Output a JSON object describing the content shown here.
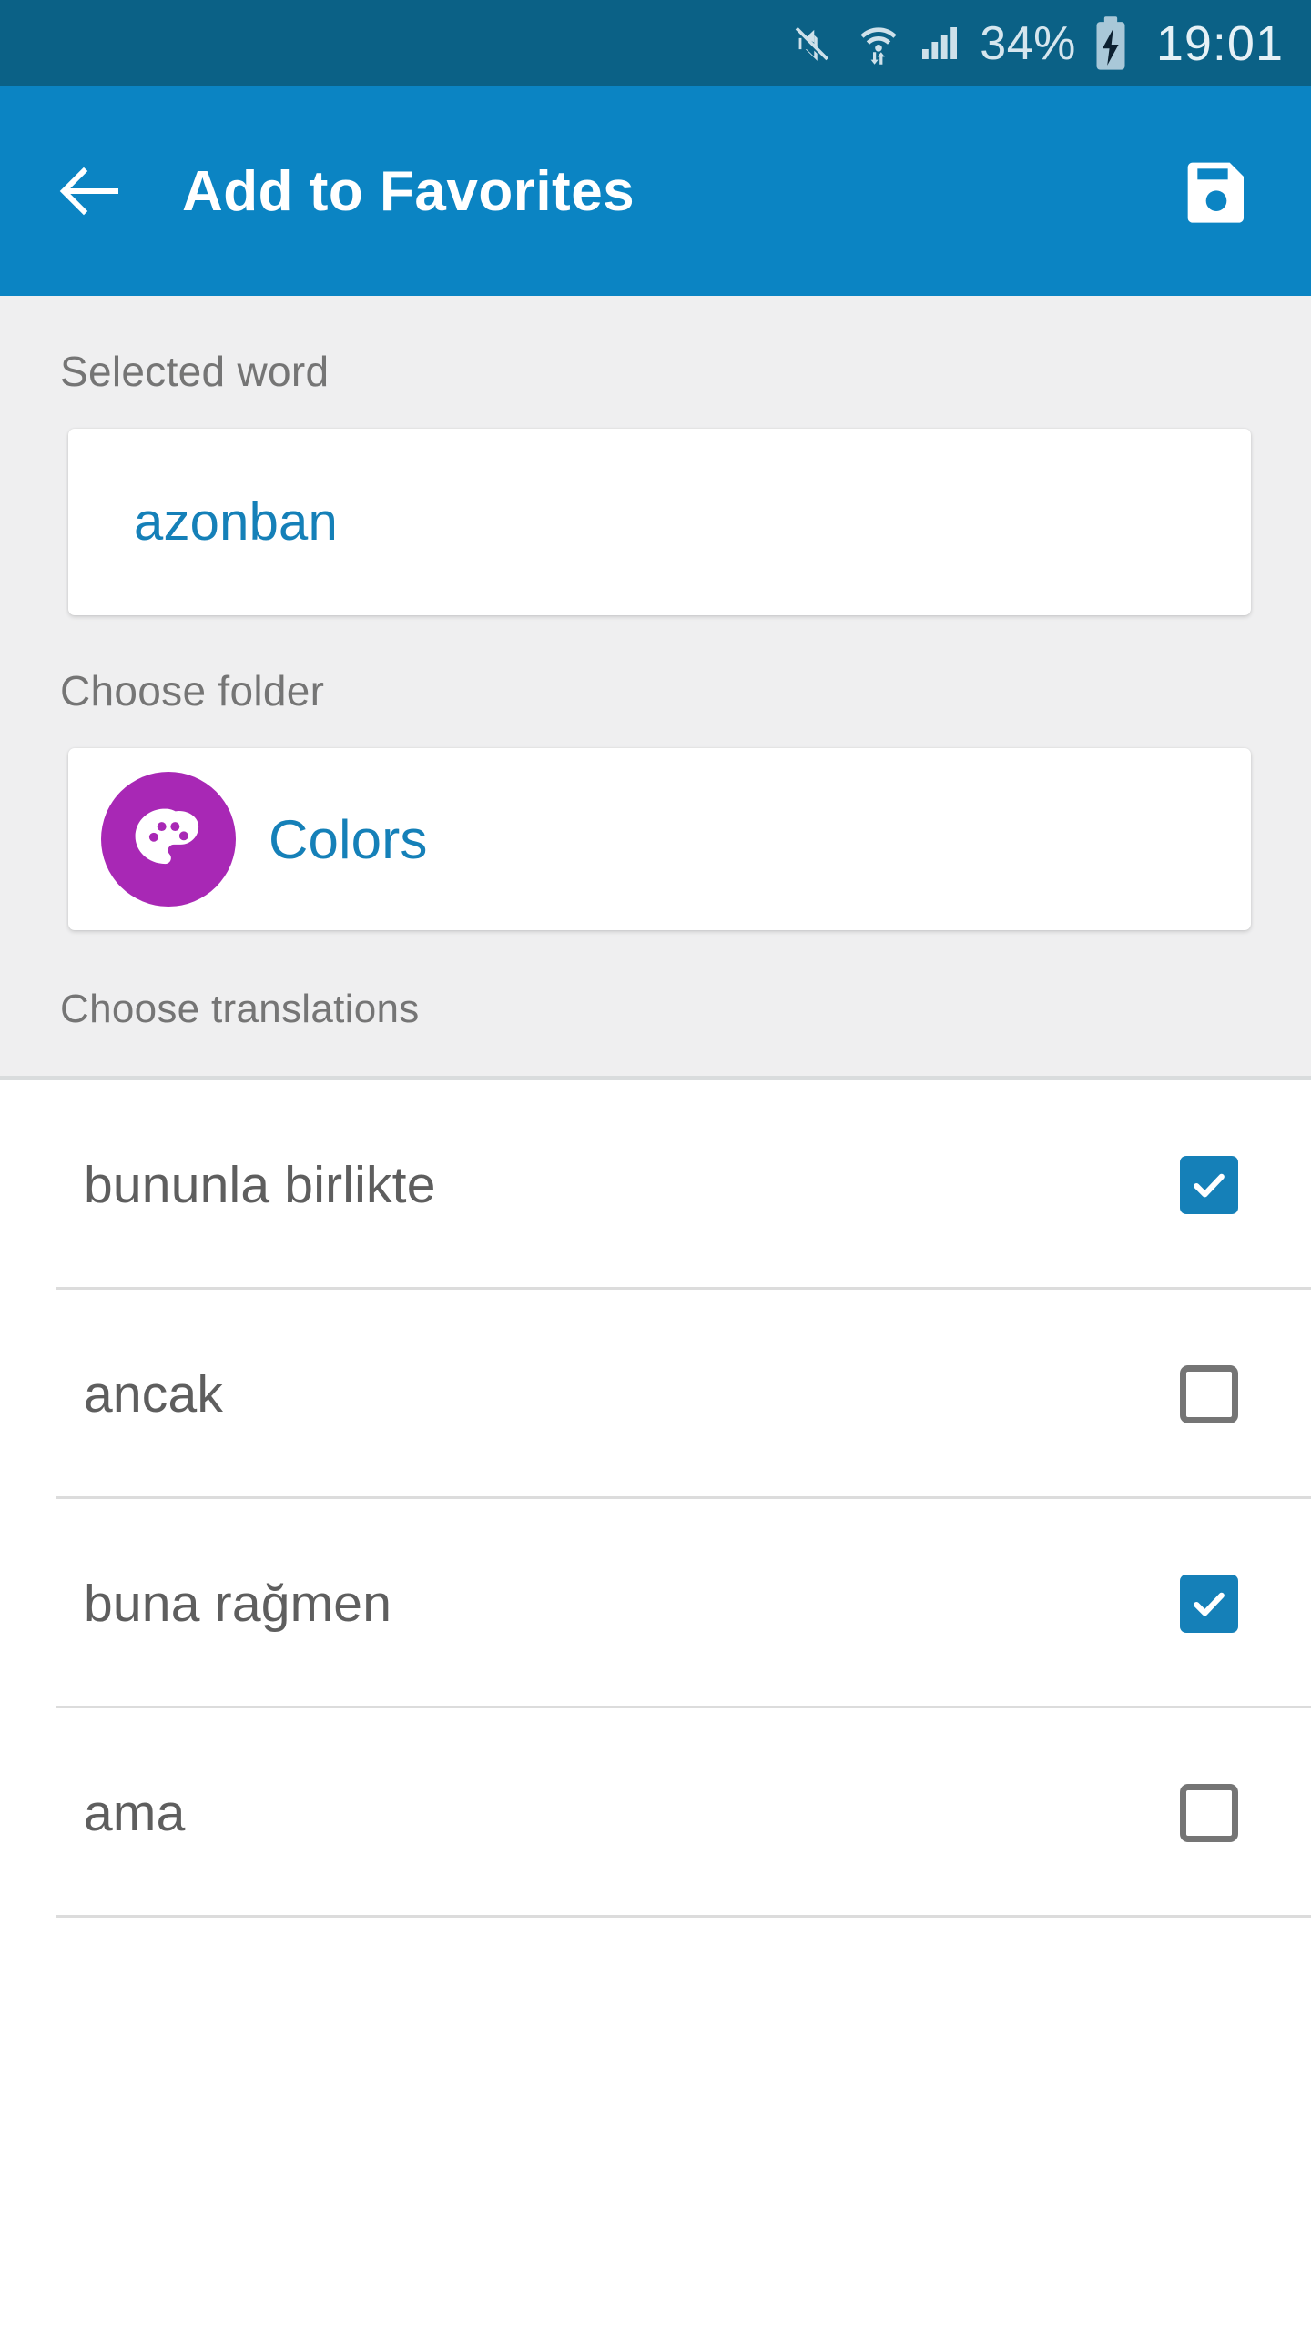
{
  "status_bar": {
    "background": "#0b6186",
    "mute_icon": "volume-mute-icon",
    "wifi_icon": "wifi-transfer-icon",
    "signal_icon": "cellular-signal-icon",
    "battery_percent": "34%",
    "battery_icon": "battery-charging-icon",
    "clock": "19:01"
  },
  "app_bar": {
    "background": "#0b84c3",
    "back_icon": "arrow-left-icon",
    "title": "Add to Favorites",
    "save_icon": "floppy-disk-save-icon"
  },
  "form": {
    "selected_word": {
      "label": "Selected word",
      "value": "azonban",
      "value_color": "#1580b8"
    },
    "choose_folder": {
      "label": "Choose folder",
      "folder_name": "Colors",
      "folder_icon": "palette-icon",
      "folder_icon_color": "#a828b5",
      "folder_name_color": "#1580b8"
    },
    "choose_translations": {
      "label": "Choose translations"
    }
  },
  "translations": [
    {
      "label": "bununla birlikte",
      "checked": true
    },
    {
      "label": "ancak",
      "checked": false
    },
    {
      "label": "buna rağmen",
      "checked": true
    },
    {
      "label": "ama",
      "checked": false
    }
  ],
  "colors": {
    "accent": "#1580b8",
    "app_bar": "#0b84c3",
    "status_bar": "#0b6186",
    "section_bg": "#efeff0",
    "checkbox_on": "#1580b8",
    "checkbox_off": "#757575"
  }
}
